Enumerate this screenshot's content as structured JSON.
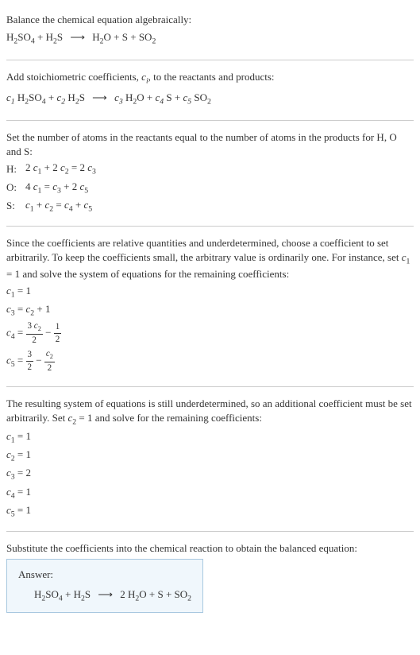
{
  "intro": {
    "line1": "Balance the chemical equation algebraically:",
    "reactants": [
      "H₂SO₄",
      "H₂S"
    ],
    "products": [
      "H₂O",
      "S",
      "SO₂"
    ]
  },
  "step1": {
    "text": "Add stoichiometric coefficients, cᵢ, to the reactants and products:",
    "coef_reactants": [
      {
        "c": "c₁",
        "sp": "H₂SO₄"
      },
      {
        "c": "c₂",
        "sp": "H₂S"
      }
    ],
    "coef_products": [
      {
        "c": "c₃",
        "sp": "H₂O"
      },
      {
        "c": "c₄",
        "sp": "S"
      },
      {
        "c": "c₅",
        "sp": "SO₂"
      }
    ]
  },
  "step2": {
    "text": "Set the number of atoms in the reactants equal to the number of atoms in the products for H, O and S:",
    "equations": [
      {
        "elem": "H:",
        "lhs": "2 c₁ + 2 c₂",
        "rhs": "2 c₃"
      },
      {
        "elem": "O:",
        "lhs": "4 c₁",
        "rhs": "c₃ + 2 c₅"
      },
      {
        "elem": "S:",
        "lhs": "c₁ + c₂",
        "rhs": "c₄ + c₅"
      }
    ]
  },
  "step3": {
    "text": "Since the coefficients are relative quantities and underdetermined, choose a coefficient to set arbitrarily. To keep the coefficients small, the arbitrary value is ordinarily one. For instance, set c₁ = 1 and solve the system of equations for the remaining coefficients:",
    "results": [
      {
        "type": "plain",
        "text": "c₁ = 1"
      },
      {
        "type": "plain",
        "text": "c₃ = c₂ + 1"
      },
      {
        "type": "frac",
        "var": "c₄",
        "num1": "3 c₂",
        "den1": "2",
        "num2": "1",
        "den2": "2",
        "op": "−"
      },
      {
        "type": "frac",
        "var": "c₅",
        "num1": "3",
        "den1": "2",
        "num2": "c₂",
        "den2": "2",
        "op": "−"
      }
    ]
  },
  "step4": {
    "text": "The resulting system of equations is still underdetermined, so an additional coefficient must be set arbitrarily. Set c₂ = 1 and solve for the remaining coefficients:",
    "results": [
      "c₁ = 1",
      "c₂ = 1",
      "c₃ = 2",
      "c₄ = 1",
      "c₅ = 1"
    ]
  },
  "step5": {
    "text": "Substitute the coefficients into the chemical reaction to obtain the balanced equation:"
  },
  "answer": {
    "label": "Answer:",
    "reactants": [
      "H₂SO₄",
      "H₂S"
    ],
    "products": [
      "2 H₂O",
      "S",
      "SO₂"
    ]
  },
  "arrow": "⟶"
}
